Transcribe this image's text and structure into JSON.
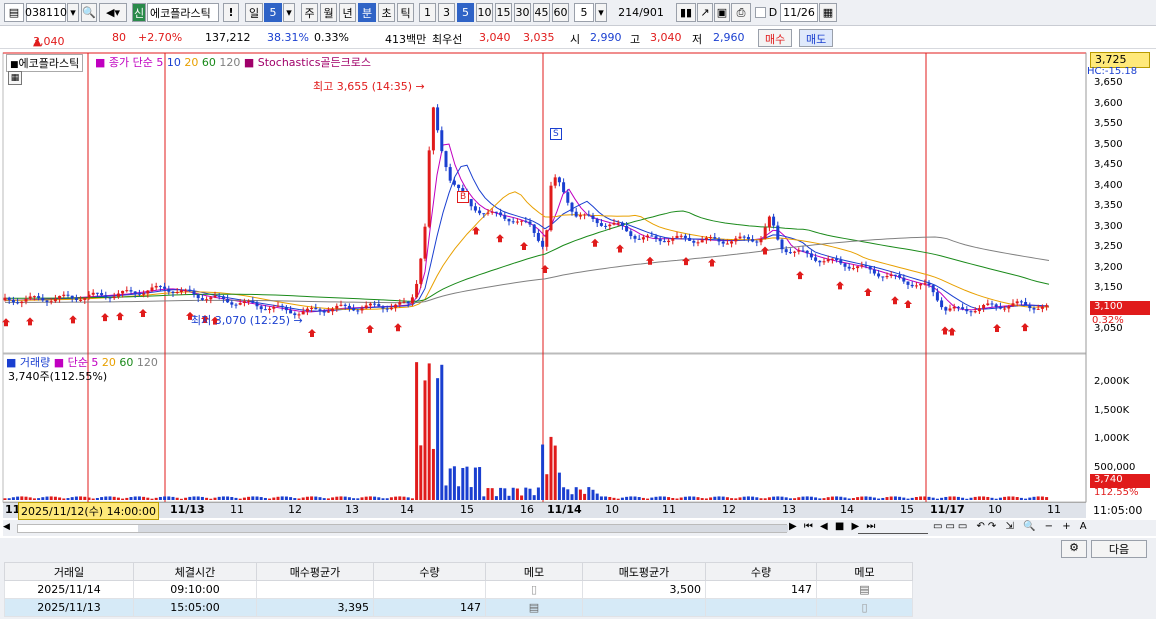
{
  "toolbar": {
    "code": "038110",
    "shin": "신",
    "name": "에코플라스틱",
    "excl": "!",
    "il": "일",
    "il_num": "5",
    "ju": "주",
    "wol": "월",
    "nyeon": "년",
    "bun": "분",
    "cho": "초",
    "tik": "틱",
    "n1": "1",
    "n3": "3",
    "n5": "5",
    "n10": "10",
    "n15": "15",
    "n30": "30",
    "n45": "45",
    "n60": "60",
    "num": "5",
    "count": "214",
    "total": "/901",
    "d_label": "D",
    "date": "11/26"
  },
  "quote": {
    "price": "3,040",
    "arrow": "▲",
    "change": "80",
    "rate": "+2.70%",
    "volume": "137,212",
    "vol_rate": "38.31%",
    "turnover": "0.33%",
    "amount": "413백만",
    "best_label": "최우선",
    "bid": "3,040",
    "ask": "3,035",
    "open_label": "시",
    "open": "2,990",
    "high_label": "고",
    "high": "3,040",
    "low_label": "저",
    "low": "2,960",
    "buy": "매수",
    "sell": "매도"
  },
  "price_panel": {
    "title": "에코플라스틱",
    "ma_label": "종가 단순",
    "ma5": "5",
    "ma10": "10",
    "ma20": "20",
    "ma60": "60",
    "ma120": "120",
    "signal": "Stochastics골든크로스",
    "high_note": "최고 3,655 (14:35)",
    "low_note": "최저 3,070 (12:25)",
    "top_value": "3,725",
    "hc": "HC:-15.18",
    "cur_price": "3,100",
    "cur_rate": "0.32%",
    "s_marker": "S",
    "b_marker": "B"
  },
  "yaxis": [
    "3,650",
    "3,600",
    "3,550",
    "3,500",
    "3,450",
    "3,400",
    "3,350",
    "3,300",
    "3,250",
    "3,200",
    "3,150",
    "3,100",
    "3,050"
  ],
  "vol_panel": {
    "title": "거래량",
    "ma_label": "단순",
    "ma5": "5",
    "ma20": "20",
    "ma60": "60",
    "ma120": "120",
    "cur": "3,740주(112.55%)",
    "axis": [
      "2,000K",
      "1,500K",
      "1,000K",
      "500,000"
    ],
    "cur_val": "3,740",
    "cur_rate": "112.55%"
  },
  "xaxis": {
    "cursor": "2025/11/12(수) 14:00:00",
    "ticks": [
      "11/13",
      "11",
      "12",
      "13",
      "14",
      "15",
      "16",
      "11/14",
      "10",
      "11",
      "12",
      "13",
      "14",
      "15",
      "11/17",
      "10",
      "11"
    ],
    "time": "11:05:00",
    "first": "11"
  },
  "bottom": {
    "next": "다음",
    "headers": [
      "거래일",
      "체결시간",
      "매수평균가",
      "수량",
      "메모",
      "매도평균가",
      "수량",
      "메모"
    ],
    "rows": [
      [
        "2025/11/14",
        "09:10:00",
        "",
        "",
        "",
        "3,500",
        "147",
        ""
      ],
      [
        "2025/11/13",
        "15:05:00",
        "3,395",
        "147",
        "",
        "",
        "",
        ""
      ]
    ]
  },
  "colors": {
    "up": "#e01b1b",
    "down": "#1a3fd0",
    "ma5": "#c000c0",
    "ma20": "#e8a000",
    "ma60": "#1a8a1a",
    "ma120": "#808080"
  },
  "chart_data": {
    "type": "candlestick",
    "ylim": [
      3025,
      3700
    ],
    "series_note": "minute bars 5-min",
    "high": 3655,
    "low": 3070,
    "last": 3100
  }
}
